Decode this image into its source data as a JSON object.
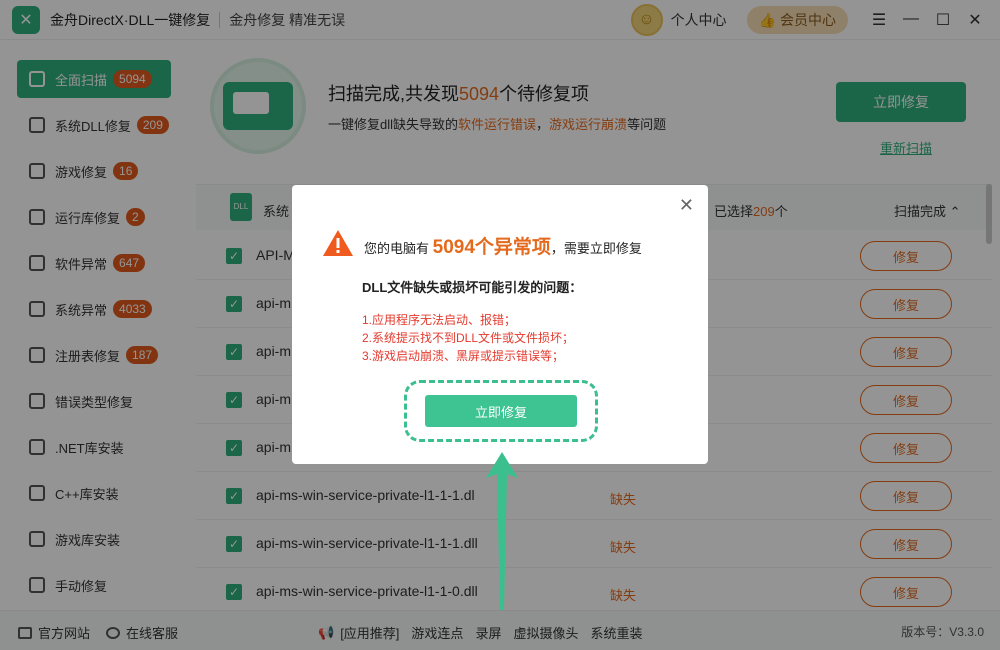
{
  "titlebar": {
    "app_title": "金舟DirectX·DLL一键修复",
    "slogan": "金舟修复 精准无误",
    "user_center": "个人中心",
    "vip_center": "会员中心"
  },
  "sidebar": {
    "items": [
      {
        "label": "全面扫描",
        "badge": "5094",
        "icon": "scan-icon"
      },
      {
        "label": "系统DLL修复",
        "badge": "209",
        "icon": "dll-icon"
      },
      {
        "label": "游戏修复",
        "badge": "16",
        "icon": "gamepad-icon"
      },
      {
        "label": "运行库修复",
        "badge": "2",
        "icon": "runtime-icon"
      },
      {
        "label": "软件异常",
        "badge": "647",
        "icon": "code-icon"
      },
      {
        "label": "系统异常",
        "badge": "4033",
        "icon": "gear-icon"
      },
      {
        "label": "注册表修复",
        "badge": "187",
        "icon": "registry-icon"
      },
      {
        "label": "错误类型修复",
        "badge": "",
        "icon": "warning-icon"
      },
      {
        "label": ".NET库安装",
        "badge": "",
        "icon": "dotnet-icon"
      },
      {
        "label": "C++库安装",
        "badge": "",
        "icon": "cpp-icon"
      },
      {
        "label": "游戏库安装",
        "badge": "",
        "icon": "pacman-icon"
      },
      {
        "label": "手动修复",
        "badge": "",
        "icon": "tools-icon"
      }
    ]
  },
  "main": {
    "scan_title_pre": "扫描完成,共发现",
    "scan_count": "5094",
    "scan_title_post": "个待修复项",
    "sub_pre": "一键修复dll缺失导致的",
    "sub_hl1": "软件运行错误",
    "sub_sep": "，",
    "sub_hl2": "游戏运行崩溃",
    "sub_post": "等问题",
    "fix_now": "立即修复",
    "rescan": "重新扫描",
    "table": {
      "col_system": "系统",
      "selected_pre": "已选择",
      "selected_count": "209",
      "selected_post": "个",
      "scan_done": "扫描完成"
    },
    "rows": [
      {
        "name": "API-M",
        "status": "",
        "action": "修复"
      },
      {
        "name": "api-m",
        "status": "",
        "action": "修复"
      },
      {
        "name": "api-m",
        "status": "",
        "action": "修复"
      },
      {
        "name": "api-m",
        "status": "",
        "action": "修复"
      },
      {
        "name": "api-m",
        "status": "",
        "action": "修复"
      },
      {
        "name": "api-ms-win-service-private-l1-1-1.dl",
        "status": "缺失",
        "action": "修复"
      },
      {
        "name": "api-ms-win-service-private-l1-1-1.dll",
        "status": "缺失",
        "action": "修复"
      },
      {
        "name": "api-ms-win-service-private-l1-1-0.dll",
        "status": "缺失",
        "action": "修复"
      }
    ]
  },
  "footer": {
    "official_site": "官方网站",
    "online_service": "在线客服",
    "recommend": "[应用推荐]",
    "links": [
      "游戏连点",
      "录屏",
      "虚拟摄像头",
      "系统重装"
    ],
    "version": "版本号：V3.3.0"
  },
  "modal": {
    "head_pre": "您的电脑有",
    "head_big": "5094个异常项",
    "head_post": "，需要立即修复",
    "question": "DLL文件缺失或损坏可能引发的问题：",
    "issues": [
      "1.应用程序无法启动、报错；",
      "2.系统提示找不到DLL文件或文件损坏；",
      "3.游戏启动崩溃、黑屏或提示错误等；"
    ],
    "cta": "立即修复"
  },
  "colors": {
    "accent": "#2fb07e",
    "warning": "#e46a1d",
    "danger": "#e43a2e"
  }
}
